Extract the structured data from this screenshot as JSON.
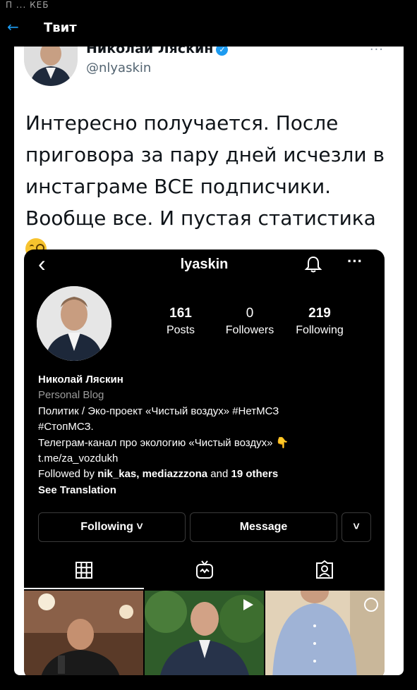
{
  "status_bar": {
    "text": "П ... КЕБ"
  },
  "header": {
    "title": "Твит"
  },
  "tweet": {
    "author_name": "Николай Ляскин",
    "handle": "@nlyaskin",
    "text": "Интересно получается. После приговора за пару дней исчезли в инстаграме ВСЕ подписчики. Вообще все. И пустая статистика"
  },
  "instagram": {
    "username": "lyaskin",
    "stats": [
      {
        "value": "161",
        "label": "Posts"
      },
      {
        "value": "0",
        "label": "Followers"
      },
      {
        "value": "219",
        "label": "Following"
      }
    ],
    "bio": {
      "name": "Николай Ляскин",
      "category": "Personal Blog",
      "line1": "Политик / Эко-проект «Чистый воздух» #НетМСЗ",
      "line2": "#СтопМСЗ.",
      "line3": "Телеграм-канал про экологию «Чистый воздух» 👇",
      "link": "t.me/za_vozdukh",
      "followed_prefix": "Followed by ",
      "followed_users": "nik_kas, mediazzzona",
      "followed_and": " and ",
      "followed_others": "19 others",
      "see_translation": "See Translation"
    },
    "buttons": {
      "following": "Following ˅",
      "message": "Message",
      "more": "˅"
    },
    "colors": {
      "background": "#000000",
      "text": "#ffffff",
      "muted": "#9b9b9b"
    }
  },
  "colors": {
    "accent": "#1d9bf0",
    "tweet_text": "#0f1419",
    "handle": "#536471"
  }
}
